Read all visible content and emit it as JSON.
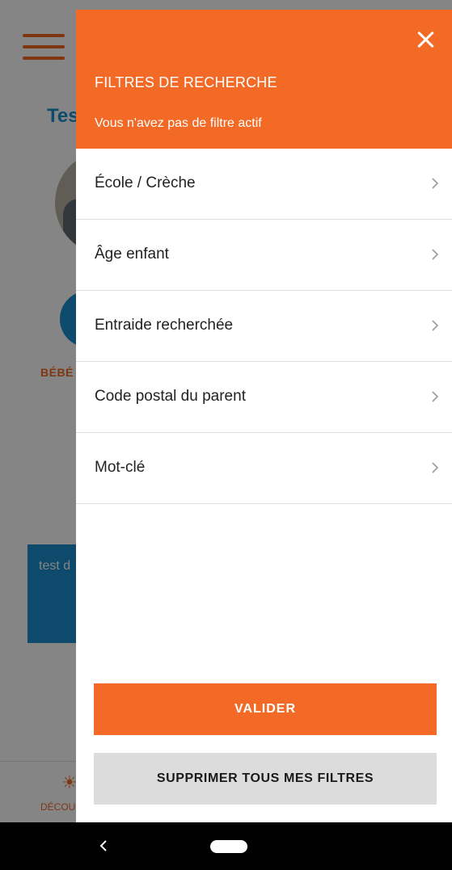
{
  "background": {
    "title": "Tes",
    "badge_label": "BÉBÉ",
    "card_text": "test d",
    "tab_label": "DÉCOU"
  },
  "drawer": {
    "title": "FILTRES DE RECHERCHE",
    "subtitle": "Vous n'avez pas de filtre actif",
    "items": [
      {
        "label": "École / Crèche"
      },
      {
        "label": "Âge enfant"
      },
      {
        "label": "Entraide recherchée"
      },
      {
        "label": "Code postal du parent"
      },
      {
        "label": "Mot-clé"
      }
    ],
    "validate_label": "VALIDER",
    "clear_label": "SUPPRIMER TOUS MES FILTRES"
  },
  "colors": {
    "accent": "#f26a25",
    "brand_blue": "#1c8fd0",
    "secondary_button": "#dcdcdc"
  },
  "icons": [
    "menu-icon",
    "close-icon",
    "chevron-right-icon",
    "nav-back-icon",
    "nav-home-icon"
  ]
}
